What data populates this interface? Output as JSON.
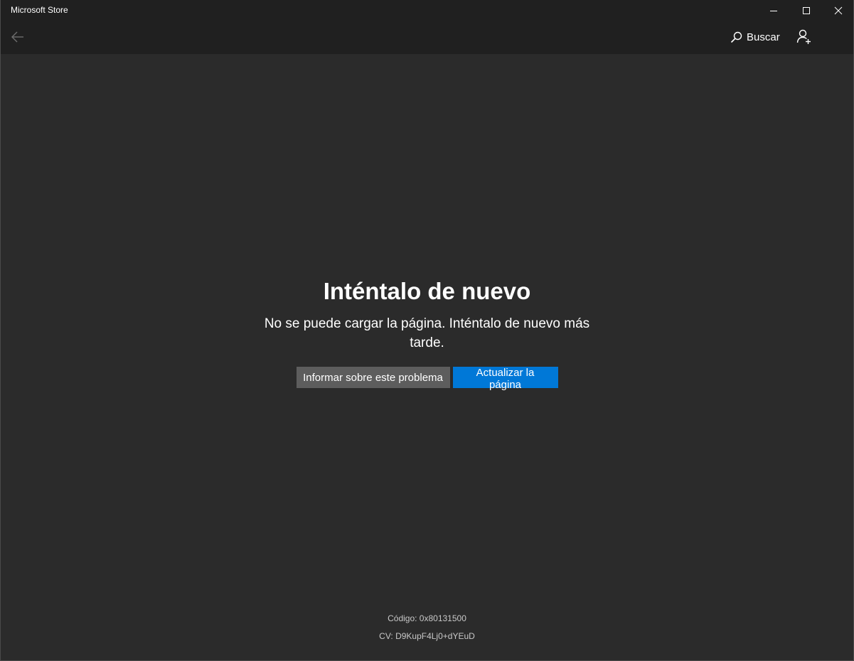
{
  "window": {
    "title": "Microsoft Store",
    "controls": {
      "minimize_icon": "minimize-icon",
      "maximize_icon": "maximize-icon",
      "close_icon": "close-icon"
    }
  },
  "appbar": {
    "back_icon": "back-arrow-icon",
    "search_label": "Buscar",
    "search_icon": "search-icon",
    "account_icon": "add-account-icon"
  },
  "error": {
    "title": "Inténtalo de nuevo",
    "message": "No se puede cargar la página. Inténtalo de nuevo más tarde.",
    "report_button": "Informar sobre este problema",
    "refresh_button": "Actualizar la página"
  },
  "footer": {
    "code": "Código: 0x80131500",
    "cv": "CV: D9KupF4Lj0+dYEuD"
  },
  "colors": {
    "background": "#2b2b2b",
    "titlebar": "#202020",
    "accent": "#0078d7",
    "secondary_button": "#5d5d5d"
  }
}
